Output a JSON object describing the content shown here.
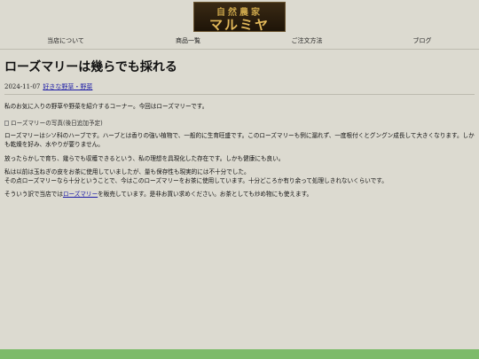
{
  "logo": {
    "line1": "自然農家",
    "line2": "マルミヤ"
  },
  "nav": [
    {
      "label": "当店について"
    },
    {
      "label": "商品一覧"
    },
    {
      "label": "ご注文方法"
    },
    {
      "label": "ブログ"
    }
  ],
  "article": {
    "title": "ローズマリーは幾らでも採れる",
    "date": "2024-11-07",
    "category": "好きな野草・野菜",
    "intro": "私のお気に入りの野草や野菜を紹介するコーナー。今回はローズマリーです。",
    "image_alt": "ローズマリーの写真(後日追加予定)",
    "para1": "ローズマリーはシソ科のハーブです。ハーブとは香りの強い植物で、一般的に生育旺盛です。このローズマリーも例に漏れず、一度根付くとグングン成長して大きくなります。しかも乾燥を好み、水やりが要りません。",
    "para2": "放ったらかしで育ち、幾らでも収穫できるという、私の理想を具現化した存在です。しかも健康にも良い。",
    "para3_line1": "私は以前は玉ねぎの皮をお茶に使用していましたが、量も保存性も現実的には不十分でした。",
    "para3_line2": "その点ローズマリーなら十分ということで、今はこのローズマリーをお茶に使用しています。十分どころか有り余って処理しきれないくらいです。",
    "para4_pre": "そういう訳で当店では",
    "para4_link": "ローズマリー",
    "para4_post": "を販売しています。是非お買い求めください。お茶としても炒め物にも使えます。"
  }
}
